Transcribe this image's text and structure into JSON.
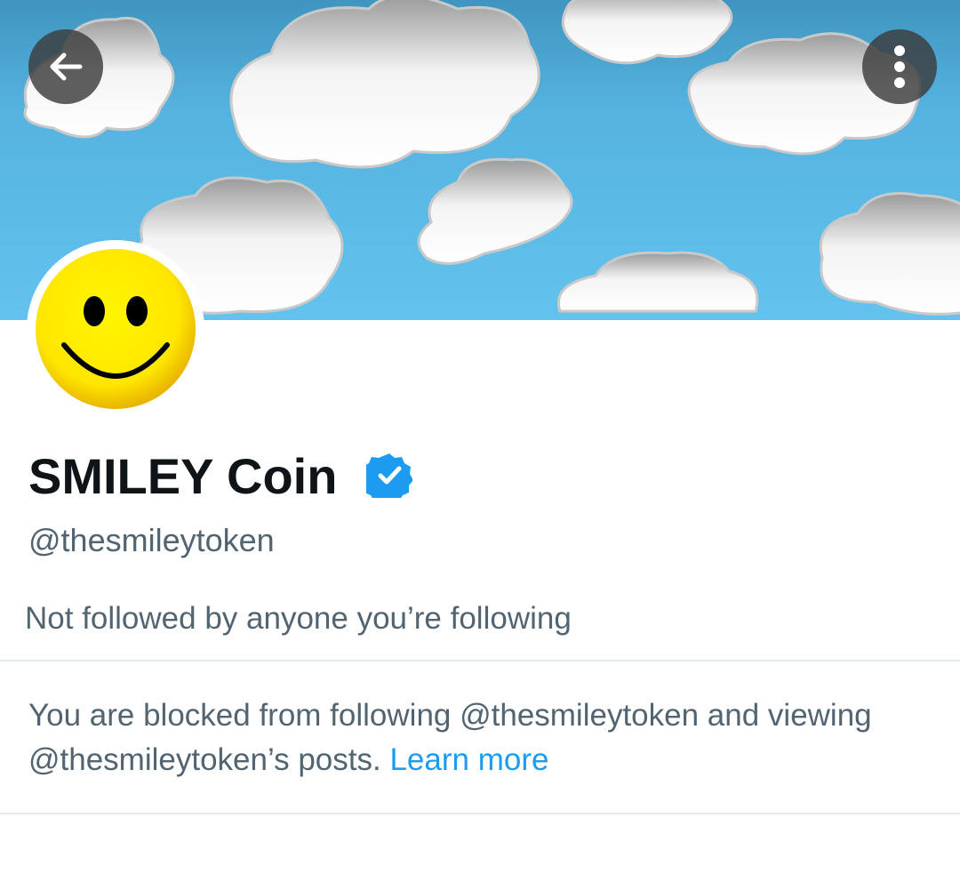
{
  "header": {
    "back_icon": "arrow-left-icon",
    "more_icon": "vertical-ellipsis-icon",
    "banner_sky_color": "#59b7e3"
  },
  "profile": {
    "display_name": "SMILEY Coin",
    "verified_icon": "verified-badge-icon",
    "verified_color": "#1d9bf0",
    "handle": "@thesmileytoken",
    "followers_note": "Not followed by anyone you’re following",
    "avatar_icon": "smiley-face-icon"
  },
  "block_notice": {
    "text": "You are blocked from following @thesmileytoken and viewing @thesmileytoken’s posts.",
    "link_label": "Learn more",
    "link_color": "#1d9bf0"
  },
  "colors": {
    "text_primary": "#0f1419",
    "text_secondary": "#536471",
    "divider": "#e6eaed"
  }
}
